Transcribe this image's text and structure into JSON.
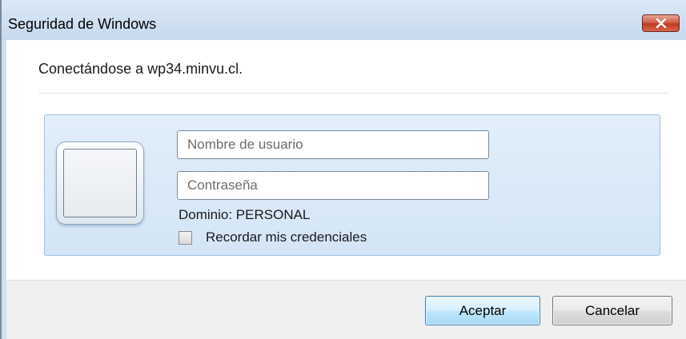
{
  "window": {
    "title": "Seguridad de Windows",
    "close_icon": "close-x-icon"
  },
  "dialog": {
    "connecting_text": "Conectándose a wp34.minvu.cl."
  },
  "credentials": {
    "avatar_icon": "user-tile-icon",
    "username": {
      "value": "",
      "placeholder": "Nombre de usuario"
    },
    "password": {
      "value": "",
      "placeholder": "Contraseña"
    },
    "domain_text": "Dominio: PERSONAL",
    "remember": {
      "label": "Recordar mis credenciales",
      "checked": false
    }
  },
  "buttons": {
    "ok_label": "Aceptar",
    "cancel_label": "Cancelar"
  },
  "colors": {
    "title_bar": "#c6d9ee",
    "close_button": "#c0391f",
    "credential_panel": "#d3e5f6",
    "footer": "#f0f0f0"
  }
}
